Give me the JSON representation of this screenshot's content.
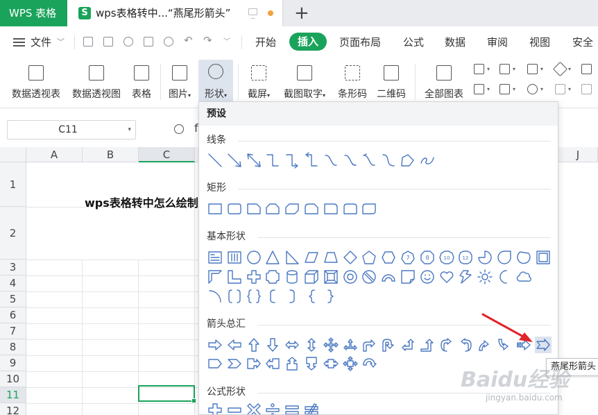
{
  "tabs": {
    "app_tab": "WPS 表格",
    "doc_tab_icon": "S",
    "doc_tab_title": "wps表格转中...“燕尾形箭头”",
    "new_tab": "+"
  },
  "menu": {
    "file": "文件",
    "items": [
      "开始",
      "插入",
      "页面布局",
      "公式",
      "数据",
      "审阅",
      "视图",
      "安全"
    ]
  },
  "ribbon": {
    "pivot_table": "数据透视表",
    "pivot_chart": "数据透视图",
    "table": "表格",
    "picture": "图片",
    "shape": "形状",
    "screenshot": "截屏",
    "ocr": "截图取字",
    "barcode": "条形码",
    "qrcode": "二维码",
    "all_charts": "全部图表"
  },
  "formula": {
    "name_box": "C11",
    "fx": "fx"
  },
  "grid": {
    "columns": [
      "A",
      "B",
      "C",
      "J"
    ],
    "rows": [
      "1",
      "2",
      "3",
      "4",
      "5",
      "6",
      "7",
      "8",
      "9",
      "10",
      "11",
      "12"
    ],
    "title_cell": "wps表格转中怎么绘制"
  },
  "shape_panel": {
    "preset": "预设",
    "sections": {
      "lines": "线条",
      "rect": "矩形",
      "basic": "基本形状",
      "arrows": "箭头总汇",
      "formula": "公式形状"
    },
    "tooltip": "燕尾形箭头"
  },
  "watermark": {
    "brand": "Baidu经验",
    "url": "jingyan.baidu.com"
  },
  "colors": {
    "accent": "#1aa35a",
    "shape_stroke": "#4a78c2",
    "annotation_arrow": "#e0262a"
  }
}
